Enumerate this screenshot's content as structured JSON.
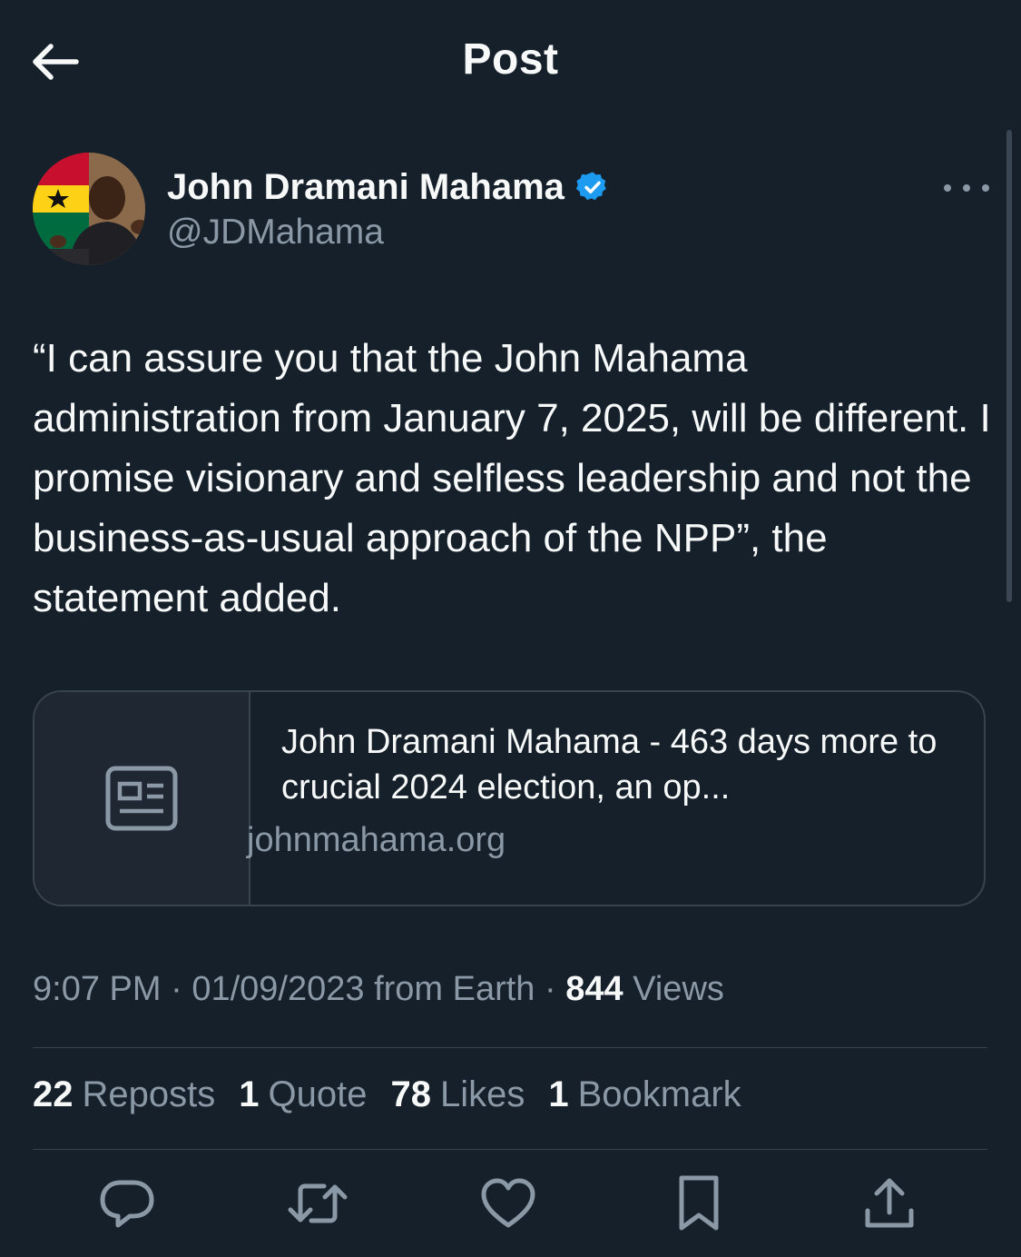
{
  "header": {
    "title": "Post"
  },
  "author": {
    "name": "John Dramani Mahama",
    "handle": "@JDMahama",
    "verified": true
  },
  "tweet": {
    "text": "“I can assure you that the John Mahama administration from January 7, 2025, will be different. I promise visionary and selfless leadership and not the business-as-usual approach of the NPP”, the statement added."
  },
  "link_card": {
    "title": "John Dramani Mahama - 463 days more to crucial 2024 election, an op...",
    "domain": "johnmahama.org",
    "thumbnail_icon": "article-icon"
  },
  "meta": {
    "time": "9:07 PM",
    "date": "01/09/2023",
    "source": "from Earth",
    "views_count": "844",
    "views_label": "Views"
  },
  "stats": [
    {
      "count": "22",
      "label": "Reposts"
    },
    {
      "count": "1",
      "label": "Quote"
    },
    {
      "count": "78",
      "label": "Likes"
    },
    {
      "count": "1",
      "label": "Bookmark"
    }
  ],
  "actions": [
    "reply-icon",
    "repost-icon",
    "like-icon",
    "bookmark-icon",
    "share-icon"
  ],
  "colors": {
    "background": "#15202b",
    "text_primary": "#f7f9f9",
    "text_secondary": "#8b98a5",
    "border": "#38444d",
    "verified_blue": "#1d9bf0"
  }
}
